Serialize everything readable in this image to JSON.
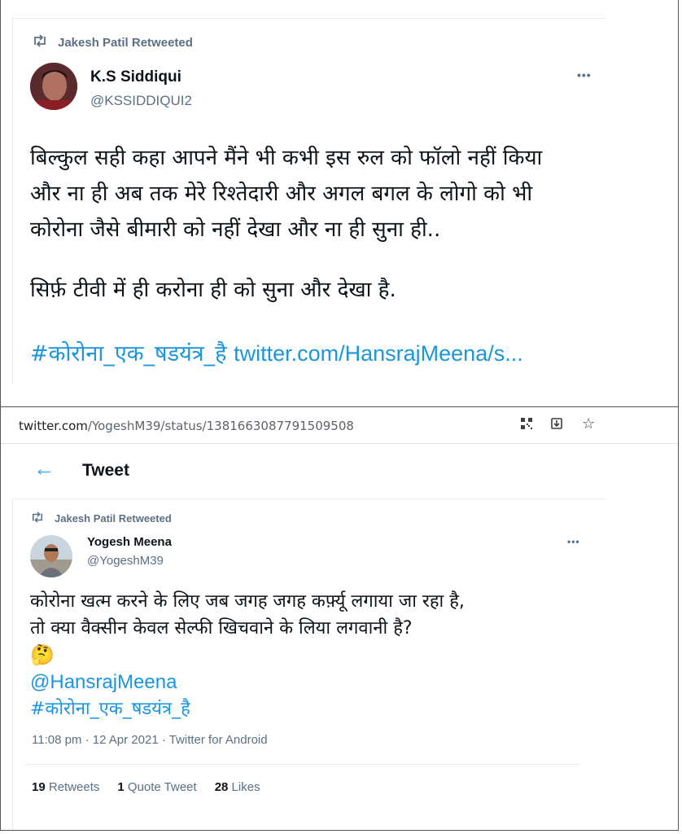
{
  "top_tweet": {
    "retweeted_by": "Jakesh Patil Retweeted",
    "author_name": "K.S Siddiqui",
    "author_handle": "@KSSIDDIQUI2",
    "more": "•••",
    "lines": [
      "बिल्कुल सही कहा आपने मैंने भी कभी इस रुल को फॉलो नहीं किया",
      "और ना ही अब तक मेरे रिश्तेदारी और अगल बगल के लोगो को भी",
      "कोरोना जैसे बीमारी को नहीं देखा और ना ही सुना ही..",
      "सिर्फ़ टीवी में ही करोना ही को सुना और देखा है."
    ],
    "hashtag": "#कोरोना_एक_षडयंत्र_है",
    "link": "twitter.com/HansrajMeena/s..."
  },
  "browser": {
    "url_domain": "twitter.com",
    "url_path": "/YogeshM39/status/1381663087791509508",
    "icons": [
      "qr-code-icon",
      "install-icon",
      "bookmark-star-icon"
    ]
  },
  "page_header": {
    "back_icon": "arrow-left-icon",
    "title": "Tweet"
  },
  "main_tweet": {
    "retweeted_by": "Jakesh Patil Retweeted",
    "author_name": "Yogesh Meena",
    "author_handle": "@YogeshM39",
    "more": "•••",
    "lines": [
      "कोरोना खत्म करने के लिए जब जगह जगह कर्फ़्यू लगाया जा रहा है,",
      "तो क्या वैक्सीन केवल सेल्फी खिचवाने के लिया लगवानी है?"
    ],
    "emoji": "🤔",
    "mention": "@HansrajMeena",
    "hashtag": "#कोरोना_एक_षडयंत्र_है",
    "timestamp": "11:08 pm · 12 Apr 2021 · Twitter for Android",
    "stats": {
      "retweets_count": "19",
      "retweets_label": "Retweets",
      "quotes_count": "1",
      "quotes_label": "Quote Tweet",
      "likes_count": "28",
      "likes_label": "Likes"
    }
  }
}
